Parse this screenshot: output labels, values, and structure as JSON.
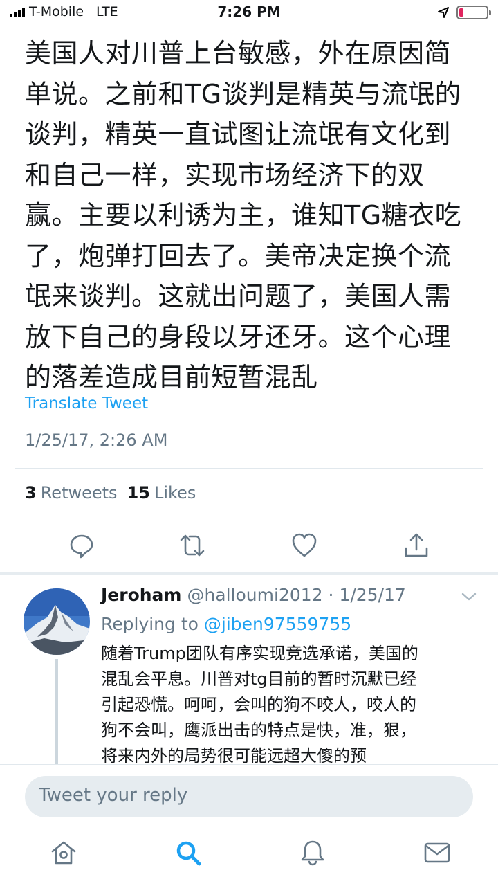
{
  "status_bar": {
    "carrier": "T-Mobile",
    "network": "LTE",
    "time": "7:26 PM",
    "battery_level": 0.15
  },
  "tweet": {
    "text": "美国人对川普上台敏感，外在原因简\n单说。之前和TG谈判是精英与流氓的\n谈判，精英一直试图让流氓有文化到\n和自己一样，实现市场经济下的双\n赢。主要以利诱为主，谁知TG糖衣吃\n了，炮弹打回去了。美帝决定换个流\n氓来谈判。这就出问题了，美国人需\n放下自己的身段以牙还牙。这个心理\n的落差造成目前短暂混乱",
    "translate_label": "Translate Tweet",
    "timestamp": "1/25/17, 2:26 AM",
    "retweets_count": "3",
    "retweets_label": "Retweets",
    "likes_count": "15",
    "likes_label": "Likes"
  },
  "actions": {
    "reply_icon": "reply-icon",
    "retweet_icon": "retweet-icon",
    "like_icon": "heart-icon",
    "share_icon": "share-icon"
  },
  "reply": {
    "name": "Jeroham",
    "handle": "@halloumi2012",
    "separator": "·",
    "date": "1/25/17",
    "replying_prefix": "Replying to",
    "replying_handle": "@jiben97559755",
    "text": "随着Trump团队有序实现竞选承诺，美国的\n混乱会平息。川普对tg目前的暂时沉默已经\n引起恐慌。呵呵，会叫的狗不咬人，咬人的\n狗不会叫，鹰派出击的特点是快，准，狠，\n将来内外的局势很可能远超大傻的预"
  },
  "composer": {
    "placeholder": "Tweet your reply"
  },
  "tab_bar": {
    "items": [
      "home-icon",
      "search-icon",
      "notifications-icon",
      "messages-icon"
    ],
    "active": "search-icon"
  },
  "colors": {
    "accent": "#1da1f2",
    "text": "#14171a",
    "secondary": "#657786",
    "divider": "#e1e8ed",
    "battery_low": "#e0245e"
  }
}
